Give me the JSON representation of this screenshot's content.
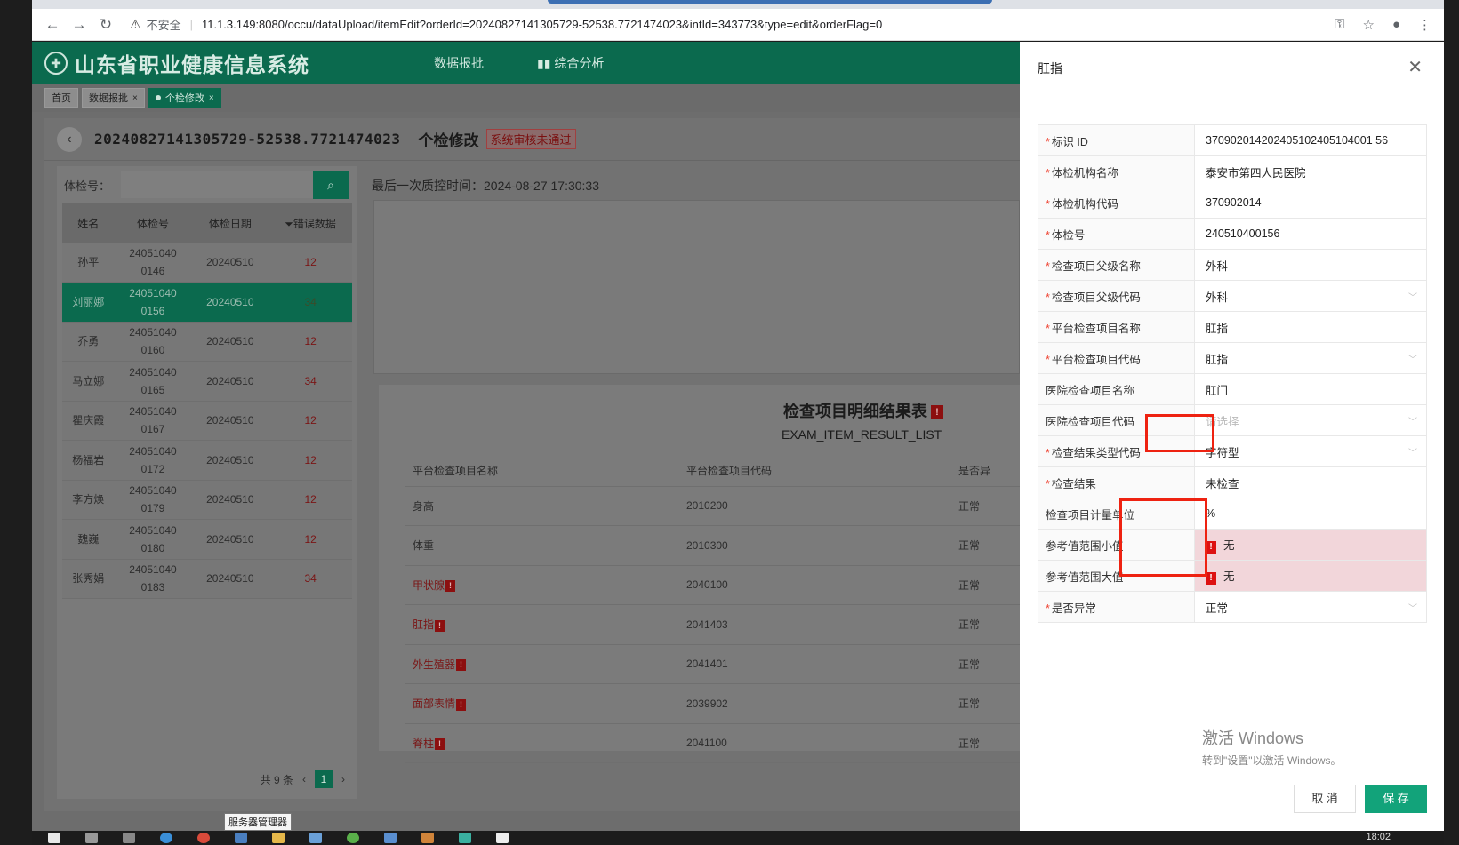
{
  "browser": {
    "insecure_label": "不安全",
    "url": "11.1.3.149:8080/occu/dataUpload/itemEdit?orderId=20240827141305729-52538.7721474023&intId=343773&type=edit&orderFlag=0"
  },
  "app": {
    "title": "山东省职业健康信息系统",
    "nav": [
      "数据报批",
      "综合分析"
    ],
    "tabs": [
      {
        "label": "首页"
      },
      {
        "label": "数据报批"
      },
      {
        "label": "个检修改"
      }
    ]
  },
  "page": {
    "order_id": "20240827141305729-52538.7721474023",
    "name": "个检修改",
    "status": "系统审核未通过",
    "search_label": "体检号：",
    "qc_time": "最后一次质控时间：2024-08-27 17:30:33"
  },
  "person_table": {
    "headers": [
      "姓名",
      "体检号",
      "体检日期",
      "错误数据"
    ],
    "filter_icon": "filter-icon",
    "rows": [
      {
        "name": "孙平",
        "id_line1": "24051040",
        "id_line2": "0146",
        "date": "20240510",
        "errors": "12"
      },
      {
        "name": "刘丽娜",
        "id_line1": "24051040",
        "id_line2": "0156",
        "date": "20240510",
        "errors": "34"
      },
      {
        "name": "乔勇",
        "id_line1": "24051040",
        "id_line2": "0160",
        "date": "20240510",
        "errors": "12"
      },
      {
        "name": "马立娜",
        "id_line1": "24051040",
        "id_line2": "0165",
        "date": "20240510",
        "errors": "34"
      },
      {
        "name": "瞿庆霞",
        "id_line1": "24051040",
        "id_line2": "0167",
        "date": "20240510",
        "errors": "12"
      },
      {
        "name": "杨福岩",
        "id_line1": "24051040",
        "id_line2": "0172",
        "date": "20240510",
        "errors": "12"
      },
      {
        "name": "李方焕",
        "id_line1": "24051040",
        "id_line2": "0179",
        "date": "20240510",
        "errors": "12"
      },
      {
        "name": "魏巍",
        "id_line1": "24051040",
        "id_line2": "0180",
        "date": "20240510",
        "errors": "12"
      },
      {
        "name": "张秀娟",
        "id_line1": "24051040",
        "id_line2": "0183",
        "date": "20240510",
        "errors": "34"
      }
    ],
    "total": "共 9 条",
    "current_page": "1"
  },
  "result": {
    "title": "检查项目明细结果表",
    "subtitle": "EXAM_ITEM_RESULT_LIST",
    "headers": [
      "平台检查项目名称",
      "平台检查项目代码",
      "是否异"
    ],
    "rows": [
      {
        "name": "身高",
        "code": "2010200",
        "status": "正常",
        "error": false
      },
      {
        "name": "体重",
        "code": "2010300",
        "status": "正常",
        "error": false
      },
      {
        "name": "甲状腺",
        "code": "2040100",
        "status": "正常",
        "error": true
      },
      {
        "name": "肛指",
        "code": "2041403",
        "status": "正常",
        "error": true
      },
      {
        "name": "外生殖器",
        "code": "2041401",
        "status": "正常",
        "error": true
      },
      {
        "name": "面部表情",
        "code": "2039902",
        "status": "正常",
        "error": true
      },
      {
        "name": "脊柱",
        "code": "2041100",
        "status": "正常",
        "error": true
      }
    ]
  },
  "drawer": {
    "title": "肛指",
    "fields": [
      {
        "label": "标识 ID",
        "value": "370902014202405102405104001 56",
        "required": true
      },
      {
        "label": "体检机构名称",
        "value": "泰安市第四人民医院",
        "required": true
      },
      {
        "label": "体检机构代码",
        "value": "370902014",
        "required": true
      },
      {
        "label": "体检号",
        "value": "240510400156",
        "required": true
      },
      {
        "label": "检查项目父级名称",
        "value": "外科",
        "required": true
      },
      {
        "label": "检查项目父级代码",
        "value": "外科",
        "required": true
      },
      {
        "label": "平台检查项目名称",
        "value": "肛指",
        "required": true
      },
      {
        "label": "平台检查项目代码",
        "value": "肛指",
        "required": true
      },
      {
        "label": "医院检查项目名称",
        "value": "肛门",
        "required": false
      },
      {
        "label": "医院检查项目代码",
        "value": "请选择",
        "required": false
      },
      {
        "label": "检查结果类型代码",
        "value": "字符型",
        "required": true
      },
      {
        "label": "检查结果",
        "value": "未检查",
        "required": true
      },
      {
        "label": "检查项目计量单位",
        "value": "%",
        "required": false
      },
      {
        "label": "参考值范围小值",
        "value": "无",
        "required": false
      },
      {
        "label": "参考值范围大值",
        "value": "无",
        "required": false
      },
      {
        "label": "是否异常",
        "value": "正常",
        "required": true
      }
    ],
    "cancel": "取 消",
    "save": "保 存",
    "watermark_title": "激活 Windows",
    "watermark_sub": "转到\"设置\"以激活 Windows。"
  },
  "taskbar": {
    "tooltip": "服务器管理器",
    "clock": "18:02"
  },
  "colors": {
    "brand": "#0b6a4e",
    "save": "#12a37a",
    "error": "#dd1111"
  }
}
